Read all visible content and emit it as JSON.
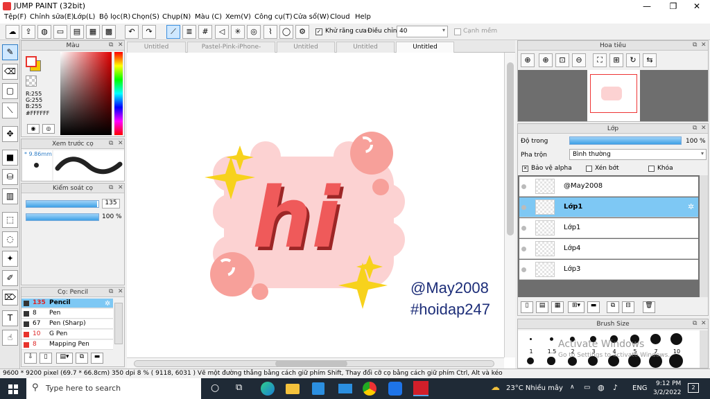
{
  "window": {
    "title": "JUMP PAINT (32bit)",
    "minimize": "—",
    "maximize": "❐",
    "close": "✕"
  },
  "menu": [
    "Tệp(F)",
    "Chỉnh sửa(E)",
    "Lớp(L)",
    "Bộ lọc(R)",
    "Chọn(S)",
    "Chụp(N)",
    "Màu (C)",
    "Xem(V)",
    "Công cụ(T)",
    "Cửa sổ(W)",
    "Cloud",
    "Help"
  ],
  "toolbar": {
    "antialias_label": "Khử răng cưa",
    "adjust_label": "Điều chỉnh",
    "adjust_value": "40",
    "snap_label": "Cạnh mềm"
  },
  "tabs": [
    {
      "label": "Untitled",
      "active": false
    },
    {
      "label": "Pastel-Pink-iPhone-Wallpaper.jpg",
      "active": false
    },
    {
      "label": "Untitled",
      "active": false
    },
    {
      "label": "Untitled",
      "active": false
    },
    {
      "label": "Untitled",
      "active": true
    }
  ],
  "color_panel": {
    "title": "Màu",
    "r": "R:255",
    "g": "G:255",
    "b": "B:255",
    "hex": "#FFFFFF",
    "fg_color": "#e8322b",
    "bg_color": "#f5c800"
  },
  "brush_preview_panel": {
    "title": "Xem trước cọ",
    "size": "* 9.86mm"
  },
  "brush_control_panel": {
    "title": "Kiểm soát cọ",
    "size_value": "135",
    "opacity_value": "100 %",
    "size_fraction": 0.98,
    "opacity_fraction": 1.0
  },
  "brush_list_panel": {
    "title": "Cọ: Pencil",
    "items": [
      {
        "size": "135",
        "name": "Pencil",
        "color": "#333333",
        "selected": true
      },
      {
        "size": "8",
        "name": "Pen",
        "color": "#333333",
        "selected": false
      },
      {
        "size": "67",
        "name": "Pen (Sharp)",
        "color": "#333333",
        "selected": false
      },
      {
        "size": "10",
        "name": "G Pen",
        "color": "#e8322b",
        "selected": false
      },
      {
        "size": "8",
        "name": "Mapping Pen",
        "color": "#e8322b",
        "selected": false
      }
    ]
  },
  "navigator_panel": {
    "title": "Hoa tiêu"
  },
  "layer_panel": {
    "title": "Lớp",
    "opacity_label": "Độ trong",
    "opacity_value": "100 %",
    "blend_label": "Pha trộn",
    "blend_value": "Bình thường",
    "protect_alpha": "Bảo vệ alpha",
    "clipping": "Xén bớt",
    "lock": "Khóa",
    "layers": [
      {
        "name": "@May2008",
        "selected": false
      },
      {
        "name": "Lớp1",
        "selected": true
      },
      {
        "name": "Lớp1",
        "selected": false
      },
      {
        "name": "Lớp4",
        "selected": false
      },
      {
        "name": "Lớp3",
        "selected": false
      }
    ]
  },
  "brush_size_panel": {
    "title": "Brush Size",
    "labels": [
      "1",
      "1.5",
      "2",
      "3",
      "4",
      "5",
      "7",
      "10"
    ]
  },
  "watermark": {
    "line1": "Activate Windows",
    "line2": "Go to Settings to activate Windows."
  },
  "artwork": {
    "main_text": "hi",
    "handle": "@May2008",
    "tag": "#hoidap247"
  },
  "status": {
    "text": "9600 * 9200 pixel  (69.7 * 66.8cm)  350 dpi   8 %  ( 9118, 6031 )  Vẽ một đường thẳng bằng cách giữ phím Shift, Thay đổi cỡ cọ bằng cách giữ phím Ctrl, Alt và kéo"
  },
  "taskbar": {
    "search_placeholder": "Type here to search",
    "weather": "23°C  Nhiều mây",
    "lang": "ENG",
    "time": "9:12 PM",
    "date": "3/2/2022",
    "notifications": "2"
  }
}
